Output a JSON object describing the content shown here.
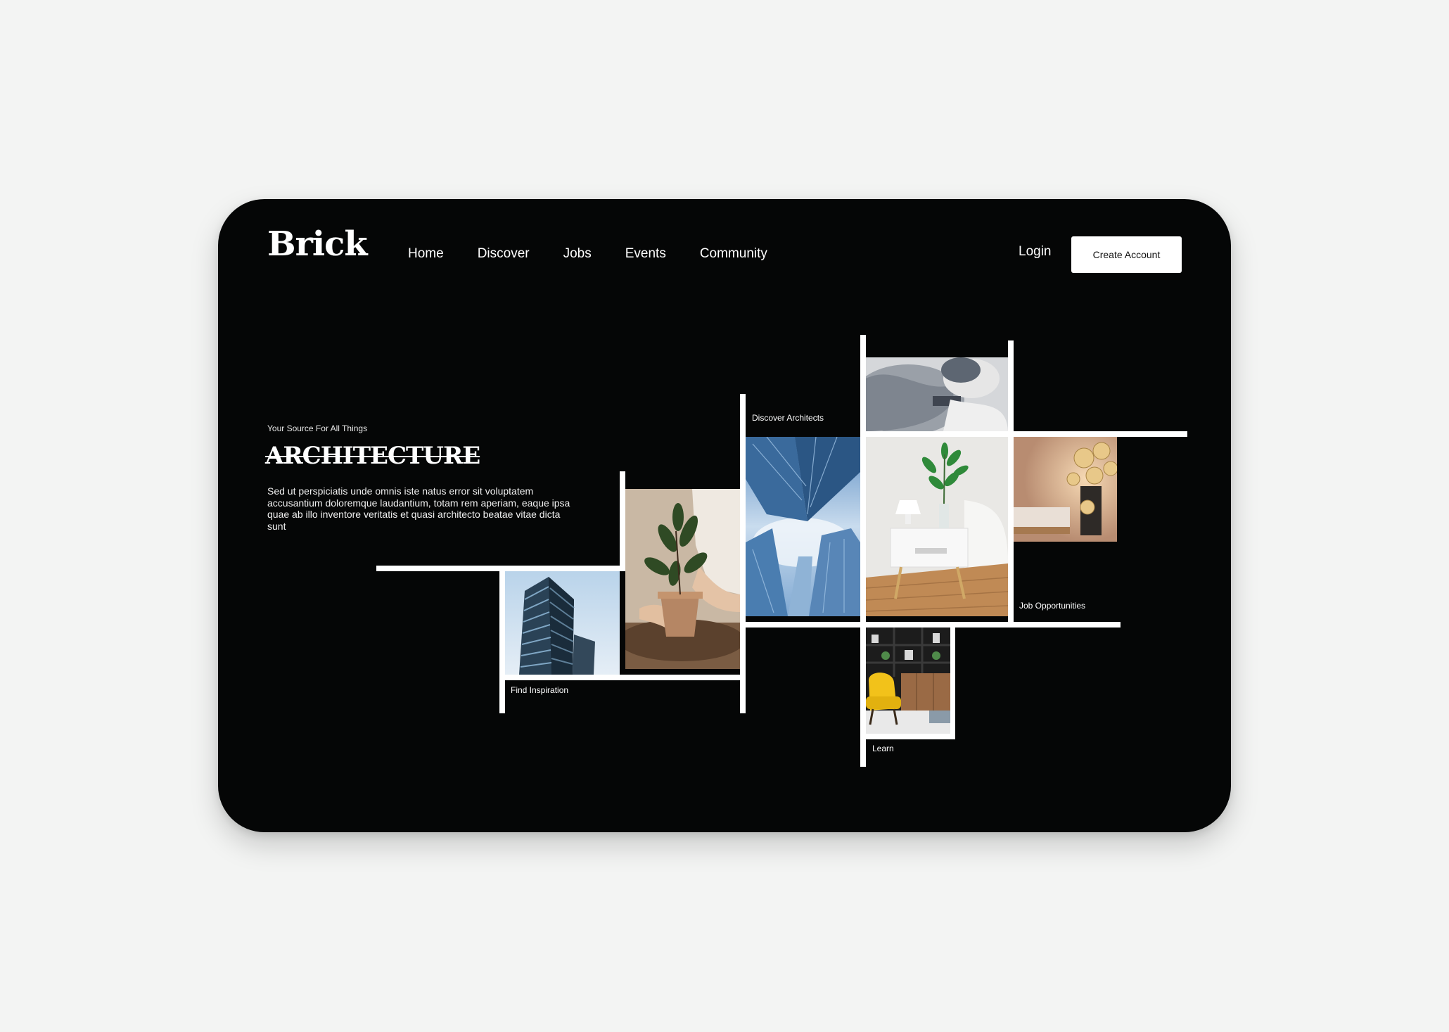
{
  "brand": {
    "logo": "Brick"
  },
  "nav": {
    "items": [
      "Home",
      "Discover",
      "Jobs",
      "Events",
      "Community"
    ]
  },
  "auth": {
    "login": "Login",
    "create_account": "Create Account"
  },
  "hero": {
    "eyebrow": "Your Source For All Things",
    "title": "ARCHITECTURE",
    "description": "Sed ut perspiciatis unde omnis iste natus error sit voluptatem accusantium doloremque laudantium, totam rem aperiam, eaque ipsa quae ab illo inventore veritatis et quasi architecto beatae vitae dicta sunt"
  },
  "tiles": {
    "find_inspiration": "Find Inspiration",
    "discover_architects": "Discover Architects",
    "job_opportunities": "Job Opportunities",
    "learn": "Learn"
  },
  "images": {
    "building_facade": "photo-building-facade",
    "potted_plant": "photo-potted-plant",
    "skyscrapers": "photo-skyscrapers",
    "bedding": "photo-bedding",
    "nightstand": "photo-nightstand",
    "bedroom_lights": "photo-bedroom-lights",
    "yellow_chair": "photo-yellow-chair"
  },
  "colors": {
    "background": "#f3f4f3",
    "card": "#050606",
    "accent": "#ffffff"
  }
}
